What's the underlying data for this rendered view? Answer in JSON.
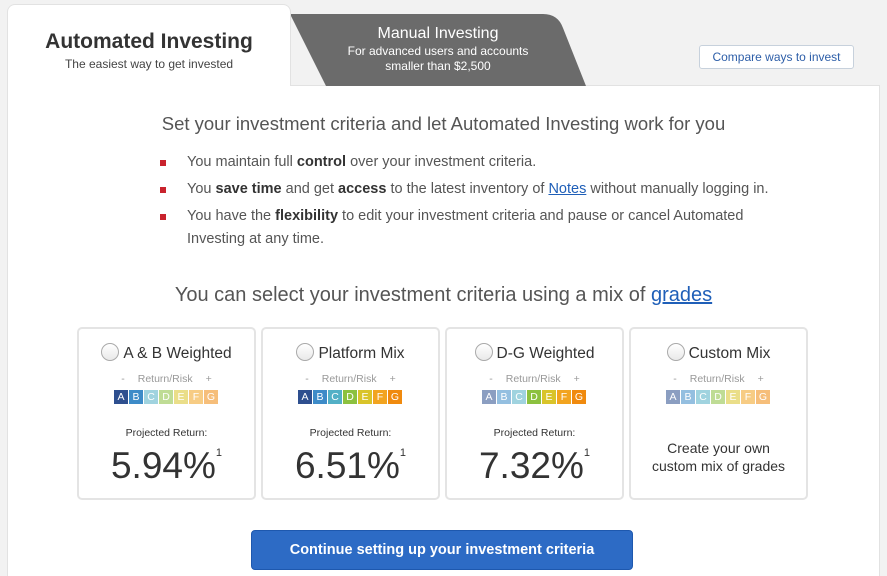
{
  "tabs": {
    "automated": {
      "title": "Automated Investing",
      "subtitle": "The easiest way to get invested"
    },
    "manual": {
      "title": "Manual Investing",
      "subtitle_line1": "For advanced users and accounts",
      "subtitle_line2": "smaller than $2,500"
    }
  },
  "compare_button": "Compare ways to invest",
  "headline": "Set your investment criteria and let Automated Investing work for you",
  "bullets": [
    {
      "p1": "You maintain full ",
      "b1": "control",
      "p2": " over your investment criteria."
    },
    {
      "p1": "You ",
      "b1": "save time",
      "p2": " and get ",
      "b2": "access",
      "p3": " to the latest inventory of ",
      "link": "Notes",
      "p4": " without manually logging in."
    },
    {
      "p1": "You have the ",
      "b1": "flexibility",
      "p2": " to edit your investment criteria and pause or cancel Automated Investing at any time."
    }
  ],
  "mix_title": {
    "text": "You can select your investment criteria using a mix of ",
    "link": "grades"
  },
  "grade_letters": [
    "A",
    "B",
    "C",
    "D",
    "E",
    "F",
    "G"
  ],
  "risk_label": {
    "minus": "-",
    "text": "Return/Risk",
    "plus": "+"
  },
  "projected_label": "Projected Return:",
  "cards": [
    {
      "name": "A & B Weighted",
      "return": "5.94%",
      "footnote": "1"
    },
    {
      "name": "Platform Mix",
      "return": "6.51%",
      "footnote": "1"
    },
    {
      "name": "D-G Weighted",
      "return": "7.32%",
      "footnote": "1"
    },
    {
      "name": "Custom Mix",
      "custom_line1": "Create your own",
      "custom_line2": "custom mix of grades"
    }
  ],
  "cta": "Continue setting up your investment criteria",
  "colors": {
    "accent": "#2d6bc5",
    "bullet": "#c9232d",
    "manual_tab": "#6b6b6b"
  }
}
